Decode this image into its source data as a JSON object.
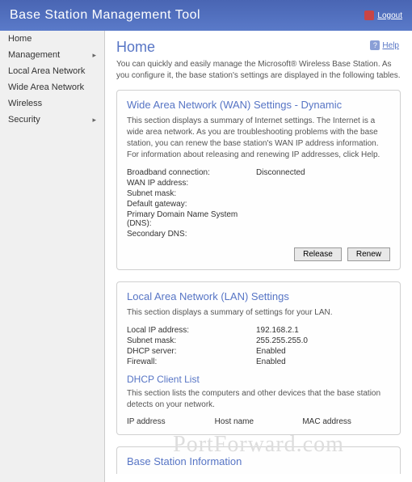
{
  "header": {
    "title": "Base Station Management Tool",
    "logout": "Logout"
  },
  "sidebar": {
    "items": [
      {
        "label": "Home",
        "expandable": false
      },
      {
        "label": "Management",
        "expandable": true
      },
      {
        "label": "Local Area Network",
        "expandable": false
      },
      {
        "label": "Wide Area Network",
        "expandable": false
      },
      {
        "label": "Wireless",
        "expandable": false
      },
      {
        "label": "Security",
        "expandable": true
      }
    ]
  },
  "main": {
    "title": "Home",
    "help": "Help",
    "intro": "You can quickly and easily manage the Microsoft® Wireless Base Station. As you configure it, the base station's settings are displayed in the following tables."
  },
  "wan": {
    "title": "Wide Area Network (WAN) Settings - Dynamic",
    "desc": "This section displays a summary of Internet settings. The Internet is a wide area network. As you are troubleshooting problems with the base station, you can renew the base station's WAN IP address information. For information about releasing and renewing IP addresses, click Help.",
    "rows": [
      {
        "label": "Broadband connection:",
        "value": "Disconnected"
      },
      {
        "label": "WAN IP address:",
        "value": ""
      },
      {
        "label": "Subnet mask:",
        "value": ""
      },
      {
        "label": "Default gateway:",
        "value": ""
      },
      {
        "label": "Primary Domain Name System (DNS):",
        "value": ""
      },
      {
        "label": "Secondary DNS:",
        "value": ""
      }
    ],
    "release_btn": "Release",
    "renew_btn": "Renew"
  },
  "lan": {
    "title": "Local Area Network (LAN) Settings",
    "desc": "This section displays a summary of settings for your LAN.",
    "rows": [
      {
        "label": "Local IP address:",
        "value": "192.168.2.1"
      },
      {
        "label": "Subnet mask:",
        "value": "255.255.255.0"
      },
      {
        "label": "DHCP server:",
        "value": "Enabled"
      },
      {
        "label": "Firewall:",
        "value": "Enabled"
      }
    ],
    "dhcp_title": "DHCP Client List",
    "dhcp_desc": "This section lists the computers and other devices that the base station detects on your network.",
    "cols": {
      "ip": "IP address",
      "host": "Host name",
      "mac": "MAC address"
    }
  },
  "bsi": {
    "title": "Base Station Information"
  },
  "watermark": "PortForward.com"
}
